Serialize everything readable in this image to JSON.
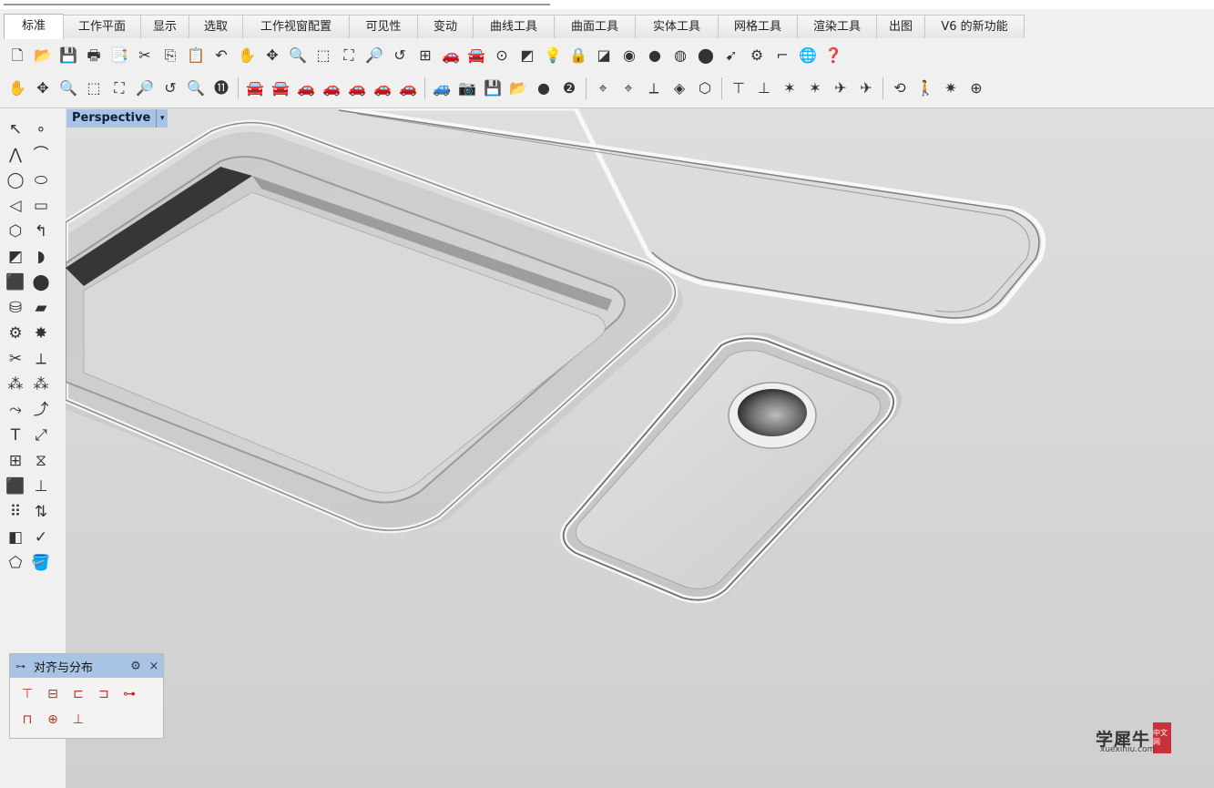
{
  "tabs": [
    "标准",
    "工作平面",
    "显示",
    "选取",
    "工作视窗配置",
    "可见性",
    "变动",
    "曲线工具",
    "曲面工具",
    "实体工具",
    "网格工具",
    "渲染工具",
    "出图",
    "V6 的新功能"
  ],
  "active_tab": "标准",
  "toolbar1": [
    {
      "name": "new-file-icon",
      "glyph": "🗋"
    },
    {
      "name": "open-folder-icon",
      "glyph": "📂"
    },
    {
      "name": "save-icon",
      "glyph": "💾"
    },
    {
      "name": "print-icon",
      "glyph": "🖶"
    },
    {
      "name": "import-icon",
      "glyph": "📑"
    },
    {
      "name": "cut-icon",
      "glyph": "✂"
    },
    {
      "name": "copy-icon",
      "glyph": "⎘"
    },
    {
      "name": "paste-icon",
      "glyph": "📋"
    },
    {
      "name": "undo-icon",
      "glyph": "↶"
    },
    {
      "name": "pan-hand-icon",
      "glyph": "✋"
    },
    {
      "name": "rotate-view-icon",
      "glyph": "✥"
    },
    {
      "name": "zoom-icon",
      "glyph": "🔍"
    },
    {
      "name": "zoom-window-icon",
      "glyph": "⬚"
    },
    {
      "name": "zoom-extents-icon",
      "glyph": "⛶"
    },
    {
      "name": "zoom-selected-icon",
      "glyph": "🔎"
    },
    {
      "name": "undo-view-icon",
      "glyph": "↺"
    },
    {
      "name": "four-viewports-icon",
      "glyph": "⊞"
    },
    {
      "name": "car-wireframe-icon",
      "glyph": "🚗"
    },
    {
      "name": "car-shaded-icon",
      "glyph": "🚘"
    },
    {
      "name": "point-on-icon",
      "glyph": "⊙"
    },
    {
      "name": "layers-icon",
      "glyph": "◩"
    },
    {
      "name": "light-bulb-icon",
      "glyph": "💡"
    },
    {
      "name": "lock-icon",
      "glyph": "🔒"
    },
    {
      "name": "material-icon",
      "glyph": "◪"
    },
    {
      "name": "color-wheel-icon",
      "glyph": "◉"
    },
    {
      "name": "sphere-icon",
      "glyph": "●"
    },
    {
      "name": "sphere-render-icon",
      "glyph": "◍"
    },
    {
      "name": "blue-sphere-icon",
      "glyph": "⬤"
    },
    {
      "name": "pointer-tool-icon",
      "glyph": "➹"
    },
    {
      "name": "gear-options-icon",
      "glyph": "⚙"
    },
    {
      "name": "dimension-icon",
      "glyph": "⌐"
    },
    {
      "name": "globe-icon",
      "glyph": "🌐"
    },
    {
      "name": "help-icon",
      "glyph": "❓"
    }
  ],
  "toolbar2": [
    {
      "name": "pan-icon",
      "glyph": "✋"
    },
    {
      "name": "rotate-icon",
      "glyph": "✥"
    },
    {
      "name": "zoom-dynamic-icon",
      "glyph": "🔍"
    },
    {
      "name": "zoom-window-icon",
      "glyph": "⬚"
    },
    {
      "name": "zoom-extents-icon",
      "glyph": "⛶"
    },
    {
      "name": "zoom-target-icon",
      "glyph": "🔎"
    },
    {
      "name": "undo-view-icon",
      "glyph": "↺"
    },
    {
      "name": "zoom-out-icon",
      "glyph": "🔍"
    },
    {
      "name": "zoom-1to1-icon",
      "glyph": "⓫"
    },
    {
      "sep": true
    },
    {
      "name": "car-red-front-icon",
      "glyph": "🚘"
    },
    {
      "name": "car-red-back-icon",
      "glyph": "🚘"
    },
    {
      "name": "car-red-top-icon",
      "glyph": "🚗"
    },
    {
      "name": "car-red-side-icon",
      "glyph": "🚗"
    },
    {
      "name": "car-red-left-icon",
      "glyph": "🚗"
    },
    {
      "name": "car-red-right-icon",
      "glyph": "🚗"
    },
    {
      "name": "car-red-perspective-icon",
      "glyph": "🚗"
    },
    {
      "sep": true
    },
    {
      "name": "car-camera-icon",
      "glyph": "🚙"
    },
    {
      "name": "camera-icon",
      "glyph": "📷"
    },
    {
      "name": "save-view-icon",
      "glyph": "💾"
    },
    {
      "name": "restore-view-icon",
      "glyph": "📂"
    },
    {
      "name": "sphere-small-icon",
      "glyph": "●"
    },
    {
      "name": "two-point-icon",
      "glyph": "❷"
    },
    {
      "sep": true
    },
    {
      "name": "target-icon",
      "glyph": "⌖"
    },
    {
      "name": "set-camera-target-icon",
      "glyph": "⌖"
    },
    {
      "name": "cplane-icon",
      "glyph": "⟂"
    },
    {
      "name": "cplane-object-icon",
      "glyph": "◈"
    },
    {
      "name": "cube-view-icon",
      "glyph": "⬡"
    },
    {
      "sep": true
    },
    {
      "name": "align-top-icon",
      "glyph": "⊤"
    },
    {
      "name": "align-mid-icon",
      "glyph": "⊥"
    },
    {
      "name": "star-icon",
      "glyph": "✶"
    },
    {
      "name": "star-alt-icon",
      "glyph": "✶"
    },
    {
      "name": "plane-icon",
      "glyph": "✈"
    },
    {
      "name": "plane-alt-icon",
      "glyph": "✈"
    },
    {
      "sep": true
    },
    {
      "name": "rotate-view-arrow-icon",
      "glyph": "⟲"
    },
    {
      "name": "walk-icon",
      "glyph": "🚶"
    },
    {
      "name": "sparkle-icon",
      "glyph": "✷"
    },
    {
      "name": "compass-icon",
      "glyph": "⊕"
    }
  ],
  "left_toolbar": [
    {
      "name": "select-arrow-icon",
      "glyph": "↖"
    },
    {
      "name": "point-icon",
      "glyph": "∘"
    },
    {
      "name": "polyline-icon",
      "glyph": "⋀"
    },
    {
      "name": "curve-icon",
      "glyph": "⌒"
    },
    {
      "name": "circle-icon",
      "glyph": "◯"
    },
    {
      "name": "ellipse-icon",
      "glyph": "⬭"
    },
    {
      "name": "arc-icon",
      "glyph": "◁"
    },
    {
      "name": "rectangle-icon",
      "glyph": "▭"
    },
    {
      "name": "polygon-icon",
      "glyph": "⬡"
    },
    {
      "name": "fillet-curve-icon",
      "glyph": "↰"
    },
    {
      "name": "surface-corner-icon",
      "glyph": "◩"
    },
    {
      "name": "extrude-surface-icon",
      "glyph": "◗"
    },
    {
      "name": "box-icon",
      "glyph": "⬛"
    },
    {
      "name": "sphere-blue-icon",
      "glyph": "⬤"
    },
    {
      "name": "cylinder-icon",
      "glyph": "⛁"
    },
    {
      "name": "mesh-plane-icon",
      "glyph": "▰"
    },
    {
      "name": "gear-tools-icon",
      "glyph": "⚙"
    },
    {
      "name": "explode-icon",
      "glyph": "✸"
    },
    {
      "name": "trim-icon",
      "glyph": "✂"
    },
    {
      "name": "split-icon",
      "glyph": "⟂"
    },
    {
      "name": "group-icon",
      "glyph": "⁂"
    },
    {
      "name": "ungroup-icon",
      "glyph": "⁂"
    },
    {
      "name": "offset-icon",
      "glyph": "⤳"
    },
    {
      "name": "fillet-icon",
      "glyph": "⤴"
    },
    {
      "name": "text-icon",
      "glyph": "T"
    },
    {
      "name": "point-edit-icon",
      "glyph": "⤢"
    },
    {
      "name": "array-icon",
      "glyph": "⊞"
    },
    {
      "name": "mirror-icon",
      "glyph": "⧖"
    },
    {
      "name": "box-edit-icon",
      "glyph": "⬛"
    },
    {
      "name": "dimension-tool-icon",
      "glyph": "⊥"
    },
    {
      "name": "grid-array-icon",
      "glyph": "⠿"
    },
    {
      "name": "flow-icon",
      "glyph": "⇅"
    },
    {
      "name": "analyze-icon",
      "glyph": "◧"
    },
    {
      "name": "check-icon",
      "glyph": "✓"
    },
    {
      "name": "render-shapes-icon",
      "glyph": "⬠"
    },
    {
      "name": "paint-bucket-icon",
      "glyph": "🪣"
    }
  ],
  "viewport": {
    "name": "Perspective"
  },
  "align_panel": {
    "title": "对齐与分布",
    "buttons": [
      {
        "name": "align-top-button",
        "glyph": "⊤"
      },
      {
        "name": "align-vcenter-button",
        "glyph": "⊟"
      },
      {
        "name": "align-left-button",
        "glyph": "⊏"
      },
      {
        "name": "align-right-button",
        "glyph": "⊐"
      },
      {
        "name": "align-hcenter-button",
        "glyph": "⊶"
      },
      {
        "name": "distribute-v-button",
        "glyph": "⊓"
      },
      {
        "name": "align-center-button",
        "glyph": "⊕"
      },
      {
        "name": "align-bottom-button",
        "glyph": "⊥"
      }
    ]
  },
  "watermark": {
    "main": "学犀牛",
    "stamp": "中文网",
    "sub": "xuexiniu.com"
  }
}
